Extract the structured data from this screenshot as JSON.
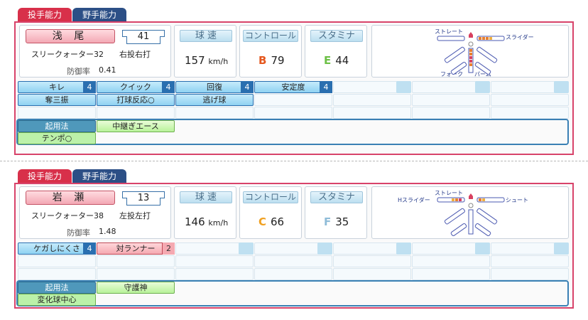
{
  "tabs": {
    "pitch": "投手能力",
    "field": "野手能力"
  },
  "players": [
    {
      "name": "浅 尾",
      "number": "41",
      "form": "スリークォーター32",
      "throw_bat": "右投右打",
      "era_label": "防御率",
      "era": "0.41",
      "speed_label": "球 速",
      "speed": "157",
      "speed_unit": "km/h",
      "control_label": "コントロール",
      "control_grade": "B",
      "control": "79",
      "control_color": "#e5581f",
      "stamina_label": "スタミナ",
      "stamina_grade": "E",
      "stamina": "44",
      "stamina_color": "#6cc046",
      "abilities": [
        {
          "label": "キレ",
          "value": "4"
        },
        {
          "label": "クイック",
          "value": "4"
        },
        {
          "label": "回復",
          "value": "4"
        },
        {
          "label": "安定度",
          "value": "4"
        },
        {
          "label": "奪三振",
          "value": ""
        },
        {
          "label": "打球反応○",
          "value": ""
        },
        {
          "label": "逃げ球",
          "value": ""
        }
      ],
      "usage_label": "起用法",
      "usage": "中継ぎエース",
      "extra": "テンポ○",
      "pitch_labels": {
        "top": "ストレート",
        "right": "スライダー",
        "bottom_left": "フォーク",
        "bottom_right": "パーム",
        "left": ""
      }
    },
    {
      "name": "岩 瀬",
      "number": "13",
      "form": "スリークォーター38",
      "throw_bat": "左投左打",
      "era_label": "防御率",
      "era": "1.48",
      "speed_label": "球 速",
      "speed": "146",
      "speed_unit": "km/h",
      "control_label": "コントロール",
      "control_grade": "C",
      "control": "66",
      "control_color": "#f0a020",
      "stamina_label": "スタミナ",
      "stamina_grade": "F",
      "stamina": "35",
      "stamina_color": "#8fbcd8",
      "abilities": [
        {
          "label": "ケガしにくさ",
          "value": "4"
        },
        {
          "label": "対ランナー",
          "value": "2"
        }
      ],
      "usage_label": "起用法",
      "usage": "守護神",
      "extra": "変化球中心",
      "pitch_labels": {
        "top": "ストレート",
        "right": "シュート",
        "left": "Hスライダー",
        "bottom_left": "",
        "bottom_right": ""
      }
    }
  ]
}
